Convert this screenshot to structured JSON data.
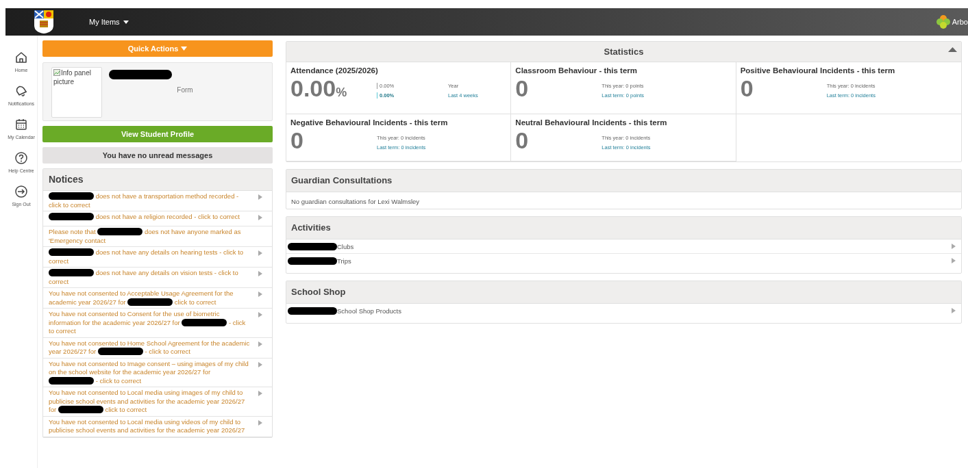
{
  "top_bar": {
    "menu_label": "My Items",
    "brand": "Arbo"
  },
  "sidebar": {
    "items": [
      {
        "kind": "home",
        "label": "Home"
      },
      {
        "kind": "bell",
        "label": "Notifications"
      },
      {
        "kind": "calendar",
        "label": "My Calendar"
      },
      {
        "kind": "help",
        "label": "Help Centre"
      },
      {
        "kind": "signout",
        "label": "Sign Out"
      }
    ]
  },
  "quick_actions": "Quick Actions",
  "info_panel": {
    "picture_alt": "Info panel picture",
    "name_redacted": true,
    "form_label": "Form"
  },
  "profile_button": "View Student Profile",
  "messages": "You have no unread messages",
  "notices": {
    "title": "Notices",
    "items": [
      {
        "arrow": true,
        "parts": [
          {
            "kind": "redacted"
          },
          {
            "kind": "text",
            "text": "does not have a transportation method recorded - click to correct"
          }
        ]
      },
      {
        "arrow": true,
        "parts": [
          {
            "kind": "redacted"
          },
          {
            "kind": "text",
            "text": "does not have a religion recorded - click to correct"
          }
        ]
      },
      {
        "arrow": false,
        "parts": [
          {
            "kind": "text",
            "text": "Please note that"
          },
          {
            "kind": "redacted"
          },
          {
            "kind": "text",
            "text": "does not have anyone marked as 'Emergency contact"
          }
        ]
      },
      {
        "arrow": true,
        "parts": [
          {
            "kind": "redacted"
          },
          {
            "kind": "text",
            "text": "does not have any details on hearing tests - click to correct"
          }
        ]
      },
      {
        "arrow": true,
        "parts": [
          {
            "kind": "redacted"
          },
          {
            "kind": "text",
            "text": "does not have any details on vision tests - click to correct"
          }
        ]
      },
      {
        "arrow": true,
        "parts": [
          {
            "kind": "text",
            "text": "You have not consented to Acceptable Usage Agreement for the academic year 2026/27 for"
          },
          {
            "kind": "redacted"
          },
          {
            "kind": "text",
            "text": "click to correct"
          }
        ]
      },
      {
        "arrow": true,
        "parts": [
          {
            "kind": "text",
            "text": "You have not consented to Consent for the use of biometric information for the academic year 2026/27 for"
          },
          {
            "kind": "redacted"
          },
          {
            "kind": "text",
            "text": "- click to correct"
          }
        ]
      },
      {
        "arrow": true,
        "parts": [
          {
            "kind": "text",
            "text": "You have not consented to Home School Agreement for the academic year 2026/27 for"
          },
          {
            "kind": "redacted"
          },
          {
            "kind": "text",
            "text": "- click to correct"
          }
        ]
      },
      {
        "arrow": true,
        "parts": [
          {
            "kind": "text",
            "text": "You have not consented to Image consent – using images of my child on the school website for the academic year 2026/27 for"
          },
          {
            "kind": "redacted"
          },
          {
            "kind": "text",
            "text": "- click to correct"
          }
        ]
      },
      {
        "arrow": true,
        "parts": [
          {
            "kind": "text",
            "text": "You have not consented to Local media using images of my child to publicise school events and activities for the academic year 2026/27 for"
          },
          {
            "kind": "redacted"
          },
          {
            "kind": "text",
            "text": "click to correct"
          }
        ]
      },
      {
        "arrow": true,
        "parts": [
          {
            "kind": "text",
            "text": "You have not consented to Local media using videos of my child to publicise school events and activities for the academic year 2026/27"
          }
        ]
      }
    ]
  },
  "statistics": {
    "title": "Statistics",
    "expanded": true,
    "cards": [
      {
        "kind": "attendance",
        "title": "Attendance (2025/2026)",
        "value": "0.00",
        "unit": "%",
        "rows": [
          {
            "value": "0.00%",
            "label": "Year",
            "link": false
          },
          {
            "value": "0.00%",
            "label": "Last 4 weeks",
            "link": true
          }
        ]
      },
      {
        "kind": "count",
        "title": "Classroom Behaviour - this term",
        "value": "0",
        "rows": [
          {
            "label": "This year: 0 points",
            "link": false
          },
          {
            "label": "Last term: 0 points",
            "link": true
          }
        ]
      },
      {
        "kind": "count",
        "title": "Positive Behavioural Incidents - this term",
        "value": "0",
        "rows": [
          {
            "label": "This year: 0 incidents",
            "link": false
          },
          {
            "label": "Last term: 0 incidents",
            "link": true
          }
        ]
      },
      {
        "kind": "count",
        "title": "Negative Behavioural Incidents - this term",
        "value": "0",
        "rows": [
          {
            "label": "This year: 0 incidents",
            "link": false
          },
          {
            "label": "Last term: 0 incidents",
            "link": true
          }
        ]
      },
      {
        "kind": "count",
        "title": "Neutral Behavioural Incidents - this term",
        "value": "0",
        "rows": [
          {
            "label": "This year: 0 incidents",
            "link": false
          },
          {
            "label": "Last term: 0 incidents",
            "link": true
          }
        ]
      }
    ]
  },
  "guardian_consultations": {
    "title": "Guardian Consultations",
    "text": "No guardian consultations for Lexi Walmsley"
  },
  "activities": {
    "title": "Activities",
    "items": [
      {
        "label": "Clubs",
        "redacted": true
      },
      {
        "label": "Trips",
        "redacted": true
      }
    ]
  },
  "school_shop": {
    "title": "School Shop",
    "items": [
      {
        "label": "School Shop Products",
        "redacted": true
      }
    ]
  }
}
